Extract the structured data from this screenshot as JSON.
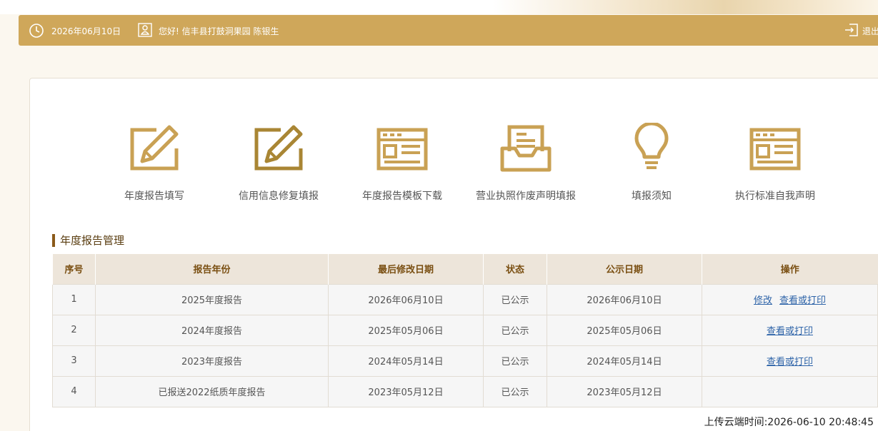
{
  "header": {
    "date": "2026年06月10日",
    "greeting": "您好!  信丰县打鼓洞果园   陈银生",
    "logout_label": "退出"
  },
  "colors": {
    "accent": "#cfa75a",
    "icon": "#c9a154",
    "title_bar": "#8a5a1a",
    "link": "#2d63a8"
  },
  "quick_links": [
    {
      "label": "年度报告填写",
      "icon": "edit-form-icon"
    },
    {
      "label": "信用信息修复填报",
      "icon": "edit-form-dark-icon"
    },
    {
      "label": "年度报告模板下载",
      "icon": "template-icon"
    },
    {
      "label": "营业执照作废声明填报",
      "icon": "inbox-tray-icon"
    },
    {
      "label": "填报须知",
      "icon": "lightbulb-icon"
    },
    {
      "label": "执行标准自我声明",
      "icon": "standard-doc-icon"
    }
  ],
  "section_title": "年度报告管理",
  "table": {
    "headers": [
      "序号",
      "报告年份",
      "最后修改日期",
      "状态",
      "公示日期",
      "操作"
    ],
    "rows": [
      {
        "no": "1",
        "year": "2025年度报告",
        "modified": "2026年06月10日",
        "status": "已公示",
        "published": "2026年06月10日",
        "actions": [
          "修改",
          "查看或打印"
        ]
      },
      {
        "no": "2",
        "year": "2024年度报告",
        "modified": "2025年05月06日",
        "status": "已公示",
        "published": "2025年05月06日",
        "actions": [
          "查看或打印"
        ]
      },
      {
        "no": "3",
        "year": "2023年度报告",
        "modified": "2024年05月14日",
        "status": "已公示",
        "published": "2024年05月14日",
        "actions": [
          "查看或打印"
        ]
      },
      {
        "no": "4",
        "year": "已报送2022纸质年度报告",
        "modified": "2023年05月12日",
        "status": "已公示",
        "published": "2023年05月12日",
        "actions": []
      }
    ]
  },
  "footer": {
    "upload_time": "上传云端时间:2026-06-10 20:48:45"
  }
}
